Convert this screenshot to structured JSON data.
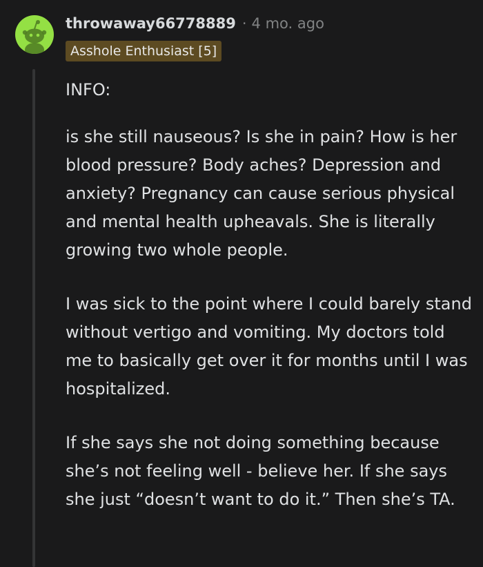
{
  "comment": {
    "username": "throwaway66778889",
    "separator": "·",
    "age": "4 mo. ago",
    "flair": "Asshole Enthusiast [5]",
    "paragraphs": [
      "INFO:",
      "is she still nauseous? Is she in pain? How is her blood pressure? Body aches? Depression and anxiety? Pregnancy can cause serious physical and mental health upheavals. She is literally growing two whole people.",
      "I was sick to the point where I could barely stand without vertigo and vomiting. My doctors told me to basically get over it for months until I was hospitalized.",
      "If she says she not doing something because she’s not feeling well - believe her. If she says she just “doesn’t want to do it.” Then she’s TA."
    ]
  },
  "colors": {
    "background": "#1a1a1b",
    "avatar_bg": "#94e044",
    "flair_bg": "#5d4b22",
    "text": "#d7dadc",
    "muted": "#818384"
  },
  "icons": {
    "avatar": "reddit-snoo-avatar-icon"
  }
}
